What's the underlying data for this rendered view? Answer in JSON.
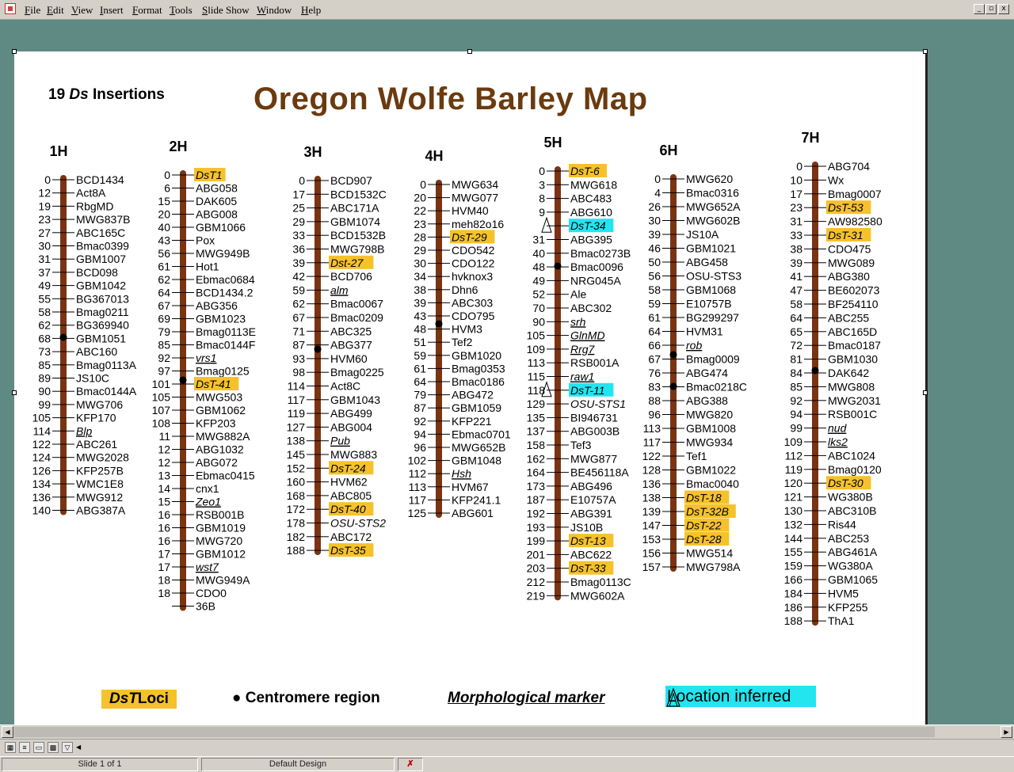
{
  "app": {
    "menus": [
      "File",
      "Edit",
      "View",
      "Insert",
      "Format",
      "Tools",
      "Slide Show",
      "Window",
      "Help"
    ],
    "window_buttons": [
      "_",
      "▫",
      "x"
    ]
  },
  "slide": {
    "title": "Oregon Wolfe Barley Map",
    "insertions_prefix": "19",
    "insertions_ds": "Ds",
    "insertions_suffix": "Insertions",
    "legend": {
      "dst_loci_italic": "DsT",
      "dst_loci_rest": "Loci",
      "centromere": "Centromere region",
      "morphological": "Morphological marker",
      "location_inferred": "Location inferred"
    },
    "colors": {
      "chromosome": "#7a3412",
      "dst_highlight": "#f5c22b",
      "inferred_highlight": "#22e5f0",
      "title": "#6b3a0f"
    },
    "chromosomes": [
      {
        "name": "1H",
        "markers": [
          [
            "0",
            "BCD1434"
          ],
          [
            "12",
            "Act8A"
          ],
          [
            "19",
            "RbgMD"
          ],
          [
            "23",
            "MWG837B"
          ],
          [
            "27",
            "ABC165C"
          ],
          [
            "30",
            "Bmac0399"
          ],
          [
            "31",
            "GBM1007"
          ],
          [
            "37",
            "BCD098"
          ],
          [
            "49",
            "GBM1042"
          ],
          [
            "55",
            "BG367013"
          ],
          [
            "58",
            "Bmag0211"
          ],
          [
            "62",
            "BG369940"
          ],
          [
            "68",
            "GBM1051"
          ],
          [
            "73",
            "ABC160"
          ],
          [
            "85",
            "Bmag0113A"
          ],
          [
            "89",
            "JS10C"
          ],
          [
            "90",
            "Bmac0144A"
          ],
          [
            "99",
            "MWG706"
          ],
          [
            "105",
            "KFP170"
          ],
          [
            "114",
            "Blp"
          ],
          [
            "122",
            "ABC261"
          ],
          [
            "124",
            "MWG2028"
          ],
          [
            "126",
            "KFP257B"
          ],
          [
            "134",
            "WMC1E8"
          ],
          [
            "136",
            "MWG912"
          ],
          [
            "140",
            "ABG387A"
          ]
        ]
      },
      {
        "name": "2H",
        "markers": [
          [
            "0",
            "DsT1"
          ],
          [
            "6",
            "ABG058"
          ],
          [
            "15",
            "DAK605"
          ],
          [
            "20",
            "ABG008"
          ],
          [
            "40",
            "GBM1066"
          ],
          [
            "43",
            "Pox"
          ],
          [
            "56",
            "MWG949B"
          ],
          [
            "61",
            "Hot1"
          ],
          [
            "62",
            "Ebmac0684"
          ],
          [
            "64",
            "BCD1434.2"
          ],
          [
            "67",
            "ABG356"
          ],
          [
            "69",
            "GBM1023"
          ],
          [
            "79",
            "Bmag0113E"
          ],
          [
            "85",
            "Bmac0144F"
          ],
          [
            "92",
            "vrs1"
          ],
          [
            "97",
            "Bmag0125"
          ],
          [
            "101",
            "DsT-41"
          ],
          [
            "105",
            "MWG503"
          ],
          [
            "107",
            "GBM1062"
          ],
          [
            "108",
            "KFP203"
          ],
          [
            "11",
            "MWG882A"
          ],
          [
            "12",
            "ABG1032"
          ],
          [
            "12",
            "ABG072"
          ],
          [
            "13",
            "Ebmac0415"
          ],
          [
            "14",
            "cnx1"
          ],
          [
            "15",
            "Zeo1"
          ],
          [
            "16",
            "RSB001B"
          ],
          [
            "16",
            "GBM1019"
          ],
          [
            "16",
            "MWG720"
          ],
          [
            "17",
            "GBM1012"
          ],
          [
            "17",
            "wst7"
          ],
          [
            "18",
            "MWG949A"
          ],
          [
            "18",
            "CDO0"
          ],
          [
            "",
            "36B"
          ]
        ]
      },
      {
        "name": "3H",
        "markers": [
          [
            "0",
            "BCD907"
          ],
          [
            "17",
            "BCD1532C"
          ],
          [
            "25",
            "ABC171A"
          ],
          [
            "29",
            "GBM1074"
          ],
          [
            "33",
            "BCD1532B"
          ],
          [
            "36",
            "MWG798B"
          ],
          [
            "39",
            "Dst-27"
          ],
          [
            "42",
            "BCD706"
          ],
          [
            "59",
            "alm"
          ],
          [
            "62",
            "Bmac0067"
          ],
          [
            "67",
            "Bmac0209"
          ],
          [
            "71",
            "ABC325"
          ],
          [
            "87",
            "ABG377"
          ],
          [
            "93",
            "HVM60"
          ],
          [
            "98",
            "Bmag0225"
          ],
          [
            "114",
            "Act8C"
          ],
          [
            "117",
            "GBM1043"
          ],
          [
            "119",
            "ABG499"
          ],
          [
            "127",
            "ABG004"
          ],
          [
            "138",
            "Pub"
          ],
          [
            "145",
            "MWG883"
          ],
          [
            "152",
            "DsT-24"
          ],
          [
            "160",
            "HVM62"
          ],
          [
            "168",
            "ABC805"
          ],
          [
            "172",
            "DsT-40"
          ],
          [
            "178",
            "OSU-STS2"
          ],
          [
            "182",
            "ABC172"
          ],
          [
            "188",
            "DsT-35"
          ]
        ]
      },
      {
        "name": "4H",
        "markers": [
          [
            "0",
            "MWG634"
          ],
          [
            "20",
            "MWG077"
          ],
          [
            "22",
            "HVM40"
          ],
          [
            "23",
            "meh82o16"
          ],
          [
            "28",
            "DsT-29"
          ],
          [
            "29",
            "CDO542"
          ],
          [
            "30",
            "CDO122"
          ],
          [
            "34",
            "hvknox3"
          ],
          [
            "38",
            "Dhn6"
          ],
          [
            "39",
            "ABC303"
          ],
          [
            "43",
            "CDO795"
          ],
          [
            "48",
            "HVM3"
          ],
          [
            "51",
            "Tef2"
          ],
          [
            "59",
            "GBM1020"
          ],
          [
            "61",
            "Bmag0353"
          ],
          [
            "64",
            "Bmac0186"
          ],
          [
            "79",
            "ABG472"
          ],
          [
            "87",
            "GBM1059"
          ],
          [
            "92",
            "KFP221"
          ],
          [
            "94",
            "Ebmac0701"
          ],
          [
            "96",
            "MWG652B"
          ],
          [
            "102",
            "GBM1048"
          ],
          [
            "112",
            "Hsh"
          ],
          [
            "113",
            "HVM67"
          ],
          [
            "117",
            "KFP241.1"
          ],
          [
            "125",
            "ABG601"
          ]
        ]
      },
      {
        "name": "5H",
        "markers": [
          [
            "0",
            "DsT-6"
          ],
          [
            "3",
            "MWG618"
          ],
          [
            "8",
            "ABC483"
          ],
          [
            "9",
            "ABG610"
          ],
          [
            "",
            "DsT-34"
          ],
          [
            "31",
            "ABG395"
          ],
          [
            "40",
            "Bmac0273B"
          ],
          [
            "48",
            "Bmac0096"
          ],
          [
            "49",
            "NRG045A"
          ],
          [
            "52",
            "Ale"
          ],
          [
            "70",
            "ABC302"
          ],
          [
            "90",
            "srh"
          ],
          [
            "105",
            "GlnMD"
          ],
          [
            "109",
            "Rrg7"
          ],
          [
            "113",
            "RSB001A"
          ],
          [
            "115",
            "raw1"
          ],
          [
            "118",
            "DsT-11"
          ],
          [
            "129",
            "OSU-STS1"
          ],
          [
            "135",
            "BI946731"
          ],
          [
            "137",
            "ABG003B"
          ],
          [
            "158",
            "Tef3"
          ],
          [
            "162",
            "MWG877"
          ],
          [
            "164",
            "BE456118A"
          ],
          [
            "173",
            "ABG496"
          ],
          [
            "187",
            "E10757A"
          ],
          [
            "192",
            "ABG391"
          ],
          [
            "193",
            "JS10B"
          ],
          [
            "199",
            "DsT-13"
          ],
          [
            "201",
            "ABC622"
          ],
          [
            "203",
            "DsT-33"
          ],
          [
            "212",
            "Bmag0113C"
          ],
          [
            "219",
            "MWG602A"
          ]
        ]
      },
      {
        "name": "6H",
        "markers": [
          [
            "0",
            "MWG620"
          ],
          [
            "4",
            "Bmac0316"
          ],
          [
            "26",
            "MWG652A"
          ],
          [
            "30",
            "MWG602B"
          ],
          [
            "39",
            "JS10A"
          ],
          [
            "46",
            "GBM1021"
          ],
          [
            "50",
            "ABG458"
          ],
          [
            "56",
            "OSU-STS3"
          ],
          [
            "58",
            "GBM1068"
          ],
          [
            "59",
            "E10757B"
          ],
          [
            "61",
            "BG299297"
          ],
          [
            "64",
            "HVM31"
          ],
          [
            "66",
            "rob"
          ],
          [
            "67",
            "Bmag0009"
          ],
          [
            "76",
            "ABG474"
          ],
          [
            "83",
            "Bmac0218C"
          ],
          [
            "88",
            "ABG388"
          ],
          [
            "96",
            "MWG820"
          ],
          [
            "113",
            "GBM1008"
          ],
          [
            "117",
            "MWG934"
          ],
          [
            "122",
            "Tef1"
          ],
          [
            "128",
            "GBM1022"
          ],
          [
            "136",
            "Bmac0040"
          ],
          [
            "138",
            "DsT-18"
          ],
          [
            "139",
            "DsT-32B"
          ],
          [
            "147",
            "DsT-22"
          ],
          [
            "153",
            "DsT-28"
          ],
          [
            "156",
            "MWG514"
          ],
          [
            "157",
            "MWG798A"
          ]
        ]
      },
      {
        "name": "7H",
        "markers": [
          [
            "0",
            "ABG704"
          ],
          [
            "10",
            "Wx"
          ],
          [
            "17",
            "Bmag0007"
          ],
          [
            "23",
            "DsT-53"
          ],
          [
            "31",
            "AW982580"
          ],
          [
            "33",
            "DsT-31"
          ],
          [
            "38",
            "CDO475"
          ],
          [
            "39",
            "MWG089"
          ],
          [
            "41",
            "ABG380"
          ],
          [
            "47",
            "BE602073"
          ],
          [
            "58",
            "BF254110"
          ],
          [
            "64",
            "ABC255"
          ],
          [
            "65",
            "ABC165D"
          ],
          [
            "72",
            "Bmac0187"
          ],
          [
            "81",
            "GBM1030"
          ],
          [
            "84",
            "DAK642"
          ],
          [
            "85",
            "MWG808"
          ],
          [
            "92",
            "MWG2031"
          ],
          [
            "94",
            "RSB001C"
          ],
          [
            "99",
            "nud"
          ],
          [
            "109",
            "lks2"
          ],
          [
            "112",
            "ABC1024"
          ],
          [
            "119",
            "Bmag0120"
          ],
          [
            "120",
            "DsT-30"
          ],
          [
            "121",
            "WG380B"
          ],
          [
            "130",
            "ABC310B"
          ],
          [
            "132",
            "Ris44"
          ],
          [
            "144",
            "ABC253"
          ],
          [
            "155",
            "ABG461A"
          ],
          [
            "159",
            "WG380A"
          ],
          [
            "166",
            "GBM1065"
          ],
          [
            "184",
            "HVM5"
          ],
          [
            "186",
            "KFP255"
          ],
          [
            "188",
            "ThA1"
          ]
        ]
      }
    ]
  },
  "status": {
    "slide_counter": "Slide 1 of 1",
    "design": "Default Design"
  }
}
